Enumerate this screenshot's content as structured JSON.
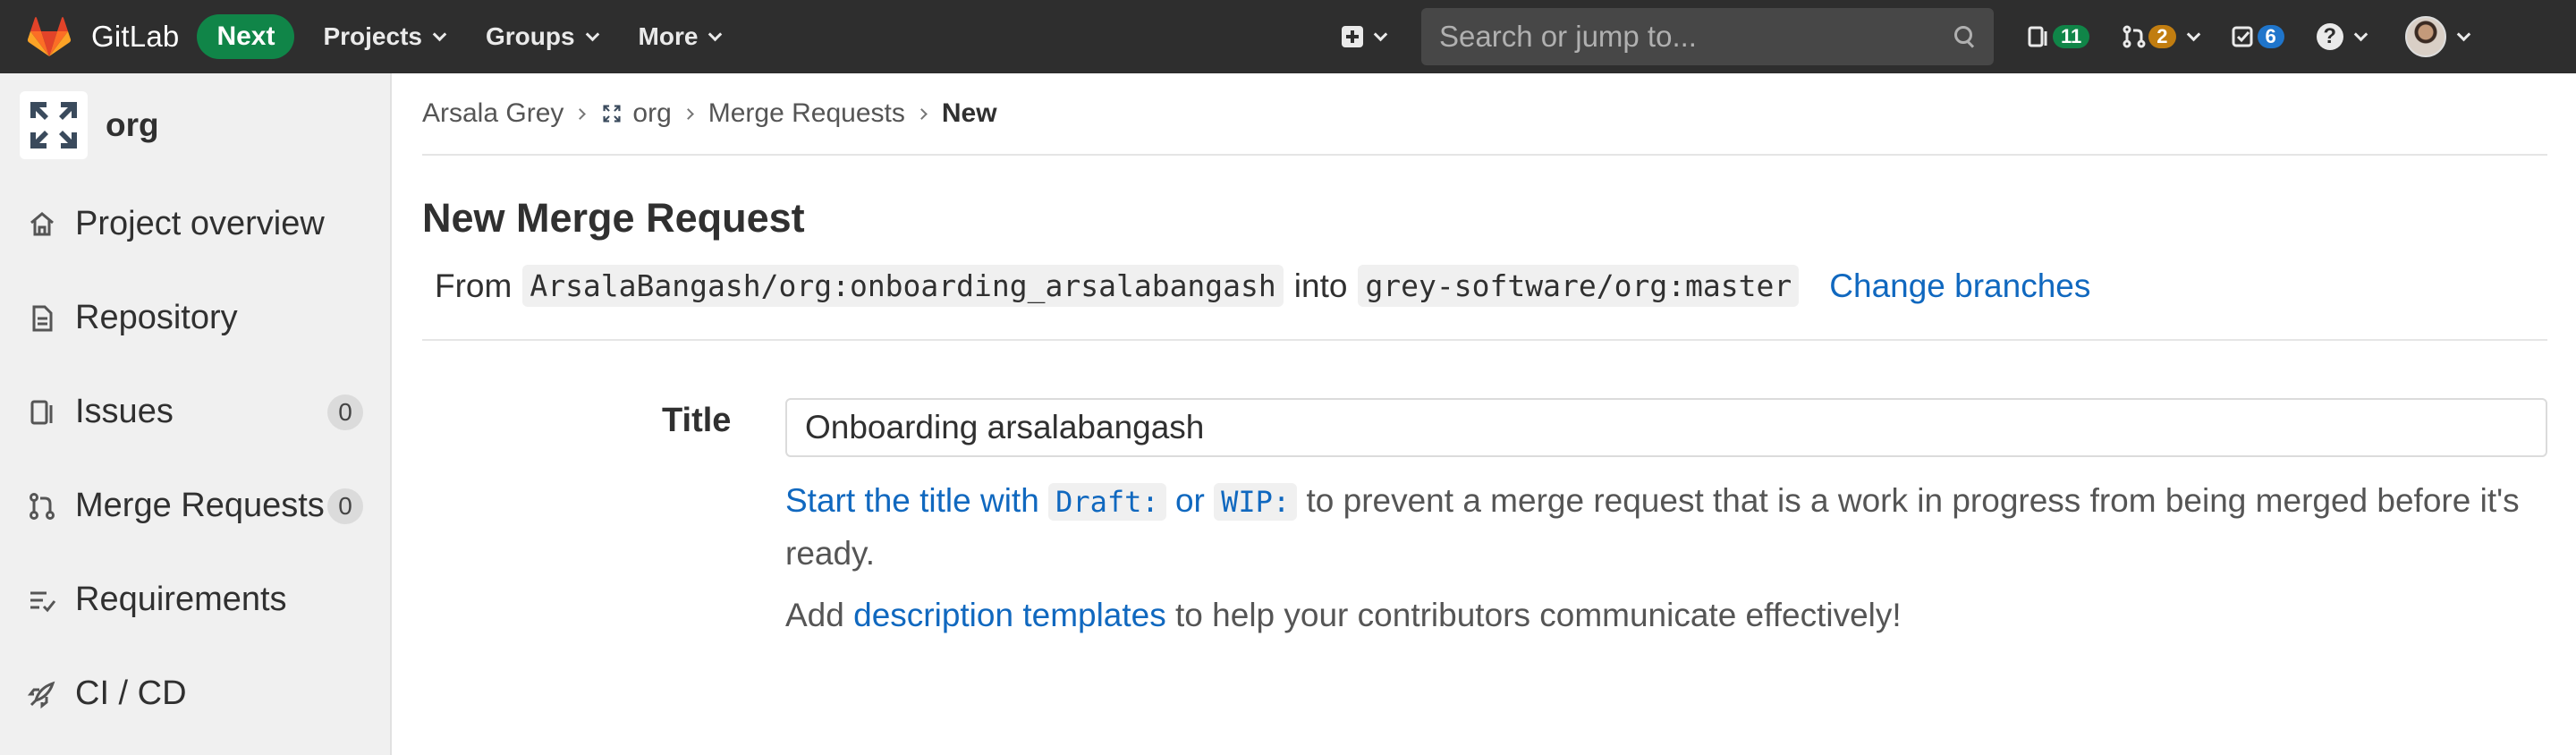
{
  "navbar": {
    "brand": "GitLab",
    "badge": "Next",
    "menu": [
      "Projects",
      "Groups",
      "More"
    ],
    "search_placeholder": "Search or jump to...",
    "issues_count": "11",
    "merge_requests_count": "2",
    "todos_count": "6"
  },
  "sidebar": {
    "project_name": "org",
    "items": [
      {
        "label": "Project overview",
        "icon": "home-icon"
      },
      {
        "label": "Repository",
        "icon": "doc-icon"
      },
      {
        "label": "Issues",
        "icon": "issues-icon",
        "count": "0"
      },
      {
        "label": "Merge Requests",
        "icon": "merge-request-icon",
        "count": "0"
      },
      {
        "label": "Requirements",
        "icon": "requirements-icon"
      },
      {
        "label": "CI / CD",
        "icon": "rocket-icon"
      }
    ]
  },
  "breadcrumb": [
    "Arsala Grey",
    "org",
    "Merge Requests",
    "New"
  ],
  "main": {
    "title": "New Merge Request",
    "from_label": "From",
    "source_branch": "ArsalaBangash/org:onboarding_arsalabangash",
    "into_label": "into",
    "target_branch": "grey-software/org:master",
    "change_branches": "Change branches",
    "form": {
      "title_label": "Title",
      "title_value": "Onboarding arsalabangash",
      "hint_link_prefix": "Start the title with",
      "hint_code_draft": "Draft:",
      "hint_or": "or",
      "hint_code_wip": "WIP:",
      "hint_suffix": "to prevent a merge request that is a work in progress from being merged before it's ready.",
      "desc_prefix": "Add",
      "desc_link": "description templates",
      "desc_suffix": "to help your contributors communicate effectively!"
    }
  },
  "colors": {
    "navbar_bg": "#2e2e2e",
    "next_badge": "#108548",
    "link": "#1068bf",
    "issues_pill": "#108548",
    "mr_pill": "#c17d10",
    "todo_pill": "#1f75cb"
  }
}
